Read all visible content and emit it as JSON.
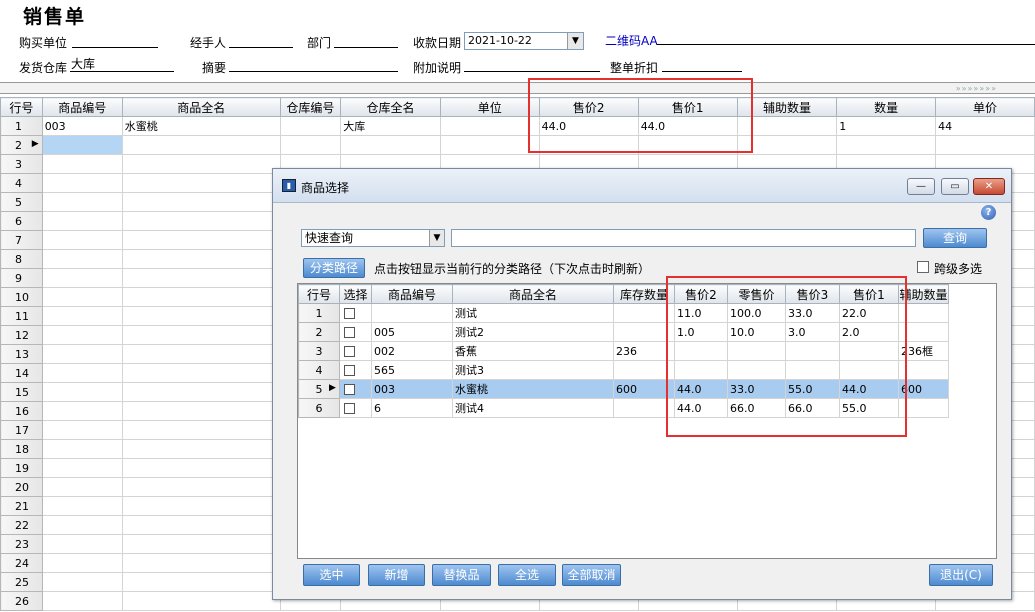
{
  "page": {
    "title": "销售单",
    "fields": {
      "buyer_label": "购买单位",
      "handler_label": "经手人",
      "dept_label": "部门",
      "date_label": "收款日期",
      "date_value": "2021-10-22",
      "qr_label": "二维码AA",
      "warehouse_label": "发货仓库",
      "warehouse_value": "大库",
      "summary_label": "摘要",
      "extra_label": "附加说明",
      "discount_label": "整单折扣"
    }
  },
  "grid": {
    "headers": [
      "行号",
      "商品编号",
      "商品全名",
      "仓库编号",
      "仓库全名",
      "单位",
      "售价2",
      "售价1",
      "辅助数量",
      "数量",
      "单价"
    ],
    "rows": [
      {
        "no": "1",
        "code": "003",
        "name": "水蜜桃",
        "wh_code": "",
        "wh_name": "大库",
        "unit": "",
        "price2": "44.0",
        "price1": "44.0",
        "aux": "",
        "qty": "1",
        "unit_price": "44"
      },
      {
        "no": "2"
      },
      {
        "no": "3"
      },
      {
        "no": "4"
      },
      {
        "no": "5"
      },
      {
        "no": "6"
      },
      {
        "no": "7"
      },
      {
        "no": "8"
      },
      {
        "no": "9"
      },
      {
        "no": "10"
      },
      {
        "no": "11"
      },
      {
        "no": "12"
      },
      {
        "no": "13"
      },
      {
        "no": "14"
      },
      {
        "no": "15"
      },
      {
        "no": "16"
      },
      {
        "no": "17"
      },
      {
        "no": "18"
      },
      {
        "no": "19"
      },
      {
        "no": "20"
      },
      {
        "no": "21"
      },
      {
        "no": "22"
      },
      {
        "no": "23"
      },
      {
        "no": "24"
      },
      {
        "no": "25"
      },
      {
        "no": "26"
      }
    ]
  },
  "dialog": {
    "title": "商品选择",
    "search_mode": "快速查询",
    "query_button": "查询",
    "category_button": "分类路径",
    "category_hint": "点击按钮显示当前行的分类路径（下次点击时刷新）",
    "cross_level_label": "跨级多选",
    "headers": [
      "行号",
      "选择",
      "商品编号",
      "商品全名",
      "库存数量",
      "售价2",
      "零售价",
      "售价3",
      "售价1",
      "辅助数量"
    ],
    "rows": [
      {
        "no": "1",
        "code": "",
        "name": "测试",
        "stock": "",
        "p2": "11.0",
        "retail": "100.0",
        "p3": "33.0",
        "p1": "22.0",
        "aux": ""
      },
      {
        "no": "2",
        "code": "005",
        "name": "测试2",
        "stock": "",
        "p2": "1.0",
        "retail": "10.0",
        "p3": "3.0",
        "p1": "2.0",
        "aux": ""
      },
      {
        "no": "3",
        "code": "002",
        "name": "香蕉",
        "stock": "236",
        "p2": "",
        "retail": "",
        "p3": "",
        "p1": "",
        "aux": "236框"
      },
      {
        "no": "4",
        "code": "565",
        "name": "测试3",
        "stock": "",
        "p2": "",
        "retail": "",
        "p3": "",
        "p1": "",
        "aux": ""
      },
      {
        "no": "5",
        "code": "003",
        "name": "水蜜桃",
        "stock": "600",
        "p2": "44.0",
        "retail": "33.0",
        "p3": "55.0",
        "p1": "44.0",
        "aux": "600"
      },
      {
        "no": "6",
        "code": "6",
        "name": "测试4",
        "stock": "",
        "p2": "44.0",
        "retail": "66.0",
        "p3": "66.0",
        "p1": "55.0",
        "aux": ""
      }
    ],
    "buttons": {
      "select": "选中",
      "add": "新增",
      "replace": "替换品",
      "select_all": "全选",
      "deselect_all": "全部取消",
      "exit": "退出(C)"
    }
  },
  "colors": {
    "highlight": "#e53030",
    "selected_row": "#a8cbf0",
    "button": "#4d8ad0"
  }
}
